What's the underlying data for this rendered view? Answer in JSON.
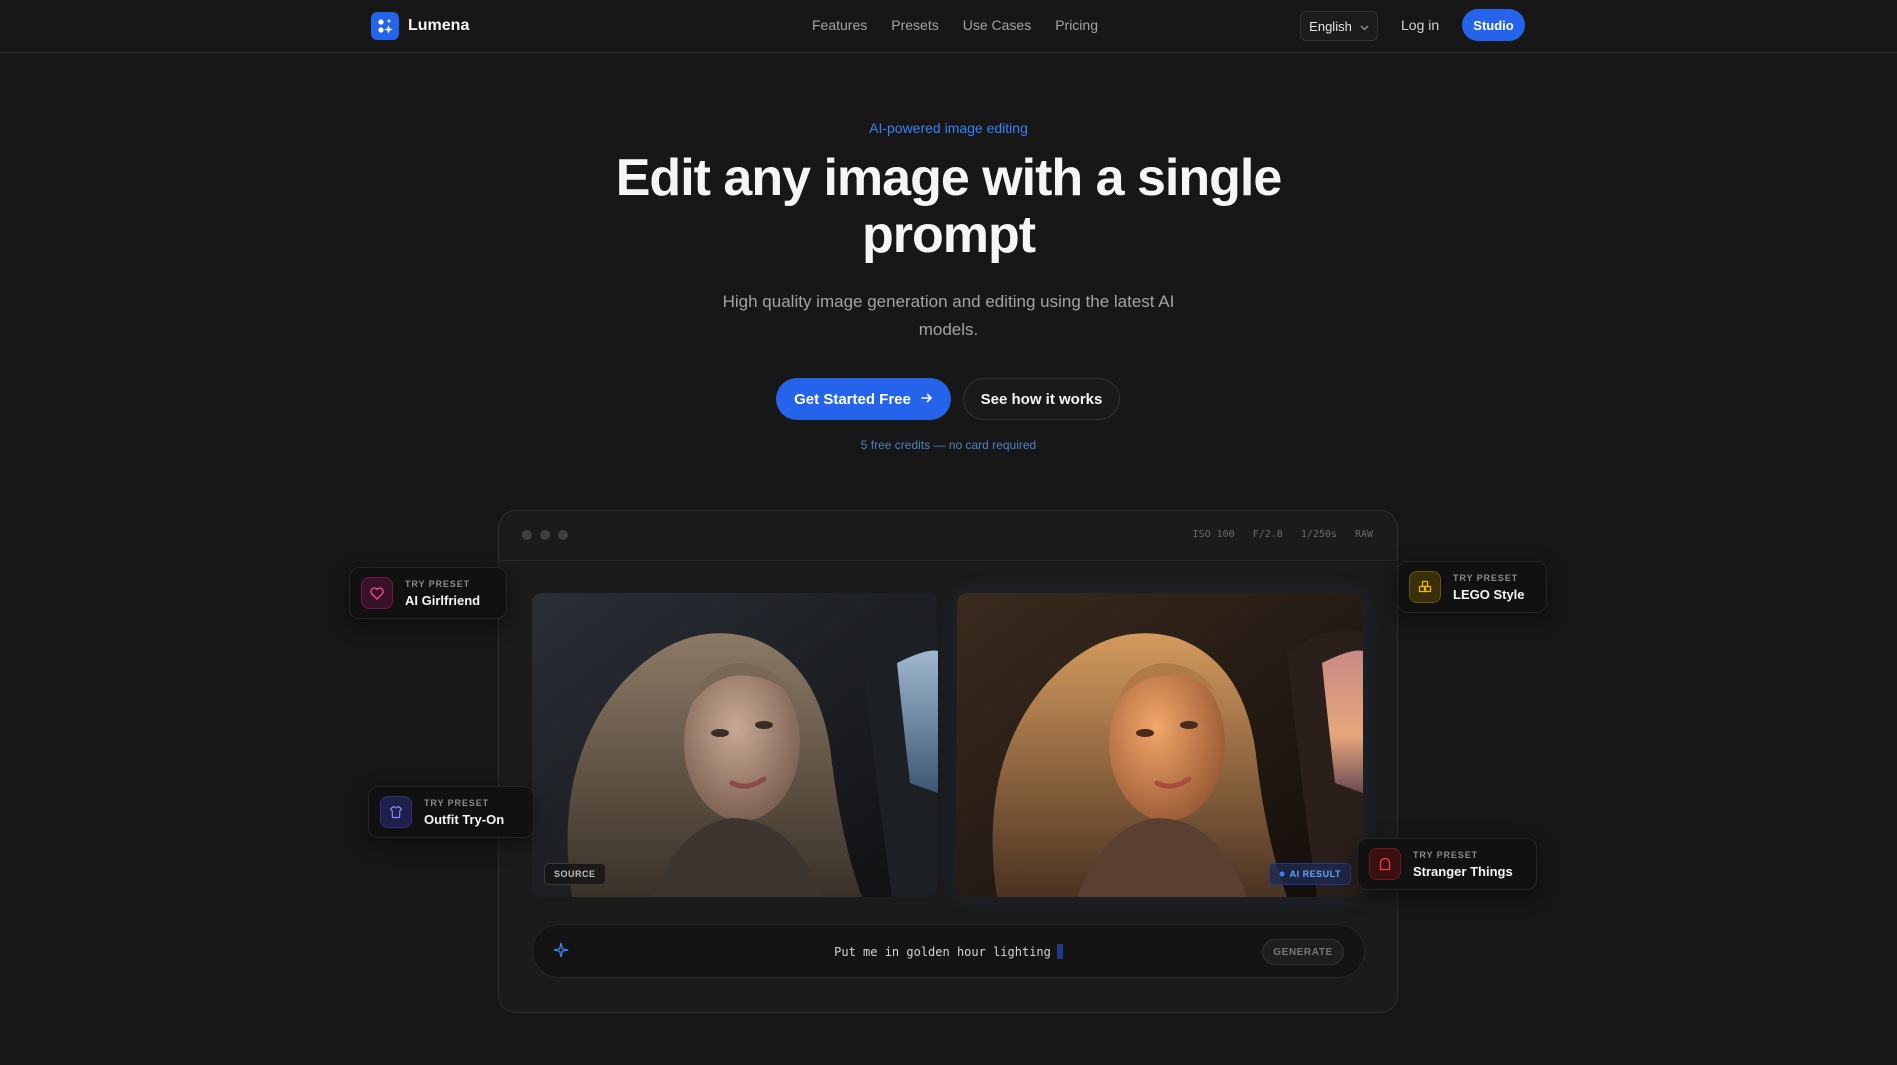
{
  "brand": {
    "name": "Lumena",
    "accent": "#2563eb"
  },
  "nav": {
    "links": [
      "Features",
      "Presets",
      "Use Cases",
      "Pricing"
    ],
    "language": "English",
    "login": "Log in",
    "studio": "Studio"
  },
  "hero": {
    "eyebrow": "AI-powered image editing",
    "title": "Edit any image with a single prompt",
    "subtitle": "High quality image generation and editing using the latest AI models.",
    "cta_primary": "Get Started Free",
    "cta_secondary": "See how it works",
    "credits_note": "5 free credits — no card required"
  },
  "demo": {
    "meta": [
      "ISO 100",
      "F/2.8",
      "1/250s",
      "RAW"
    ],
    "source_tag": "SOURCE",
    "result_tag": "AI RESULT",
    "prompt": "Put me in golden hour lighting",
    "generate": "GENERATE"
  },
  "presets": [
    {
      "kicker": "TRY PRESET",
      "name": "AI Girlfriend",
      "icon": "heart-icon",
      "color": "#ec4899"
    },
    {
      "kicker": "TRY PRESET",
      "name": "LEGO Style",
      "icon": "blocks-icon",
      "color": "#eab308"
    },
    {
      "kicker": "TRY PRESET",
      "name": "Outfit Try-On",
      "icon": "shirt-icon",
      "color": "#818cf8"
    },
    {
      "kicker": "TRY PRESET",
      "name": "Stranger Things",
      "icon": "ghost-icon",
      "color": "#ef4444"
    }
  ]
}
